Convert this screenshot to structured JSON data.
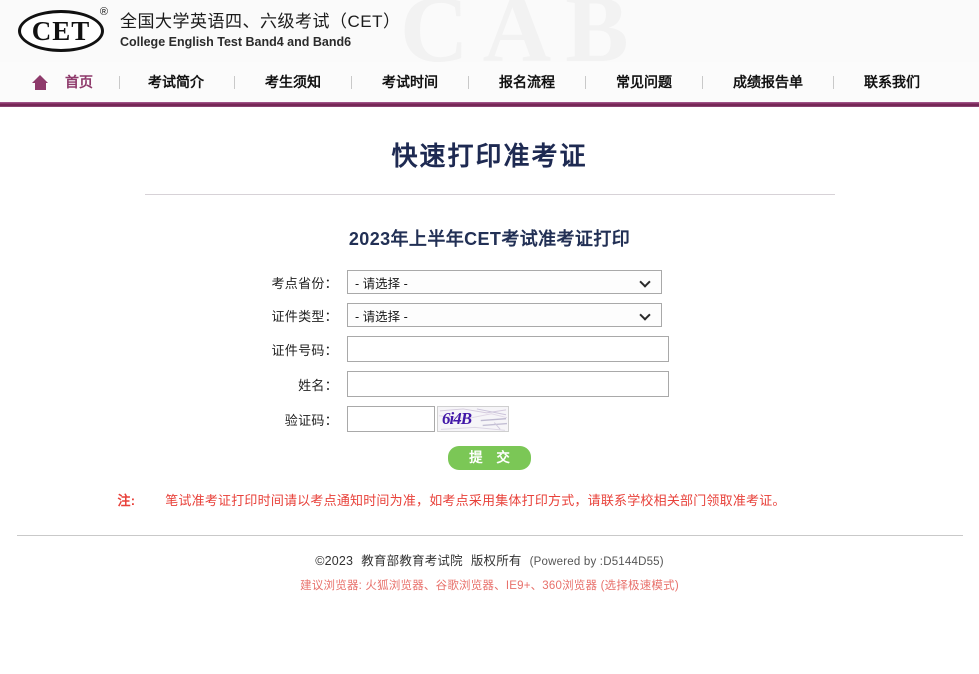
{
  "header": {
    "logo_text": "CET",
    "logo_registered": "®",
    "site_title_cn": "全国大学英语四、六级考试（CET）",
    "site_title_en": "College English Test Band4 and Band6",
    "watermark_text": "CAB"
  },
  "nav": {
    "home_icon": "home-icon",
    "items": [
      {
        "label": "首页",
        "active": true
      },
      {
        "label": "考试简介",
        "active": false
      },
      {
        "label": "考生须知",
        "active": false
      },
      {
        "label": "考试时间",
        "active": false
      },
      {
        "label": "报名流程",
        "active": false
      },
      {
        "label": "常见问题",
        "active": false
      },
      {
        "label": "成绩报告单",
        "active": false
      },
      {
        "label": "联系我们",
        "active": false
      }
    ]
  },
  "page": {
    "title": "快速打印准考证",
    "form_title": "2023年上半年CET考试准考证打印"
  },
  "form": {
    "province": {
      "label": "考点省份：",
      "value": "- 请选择 -",
      "options": [
        "- 请选择 -"
      ],
      "icon": "chevron-down-icon"
    },
    "id_type": {
      "label": "证件类型：",
      "value": "- 请选择 -",
      "options": [
        "- 请选择 -"
      ],
      "icon": "chevron-down-icon"
    },
    "id_number": {
      "label": "证件号码：",
      "value": "",
      "placeholder": ""
    },
    "name": {
      "label": "姓名：",
      "value": "",
      "placeholder": ""
    },
    "captcha": {
      "label": "验证码：",
      "value": "",
      "placeholder": "",
      "image_text": "6i4B",
      "image_color": "#4218a8"
    },
    "submit": {
      "label": "提 交",
      "color": "#7bc756"
    }
  },
  "note": {
    "key": "注:",
    "text": "笔试准考证打印时间请以考点通知时间为准，如考点采用集体打印方式，请联系学校相关部门领取准考证。",
    "color": "#e8413a"
  },
  "footer": {
    "copyright": "©2023",
    "org": "教育部教育考试院",
    "rights": "版权所有",
    "powered_by": "(Powered by :D5144D55)",
    "browsers": "建议浏览器: 火狐浏览器、谷歌浏览器、IE9+、360浏览器 (选择极速模式)",
    "browsers_color": "#e8716b"
  },
  "theme": {
    "accent_purple": "#8e3a6b",
    "title_navy": "#1e2a52",
    "submit_green": "#7bc756",
    "note_red": "#e8413a"
  }
}
